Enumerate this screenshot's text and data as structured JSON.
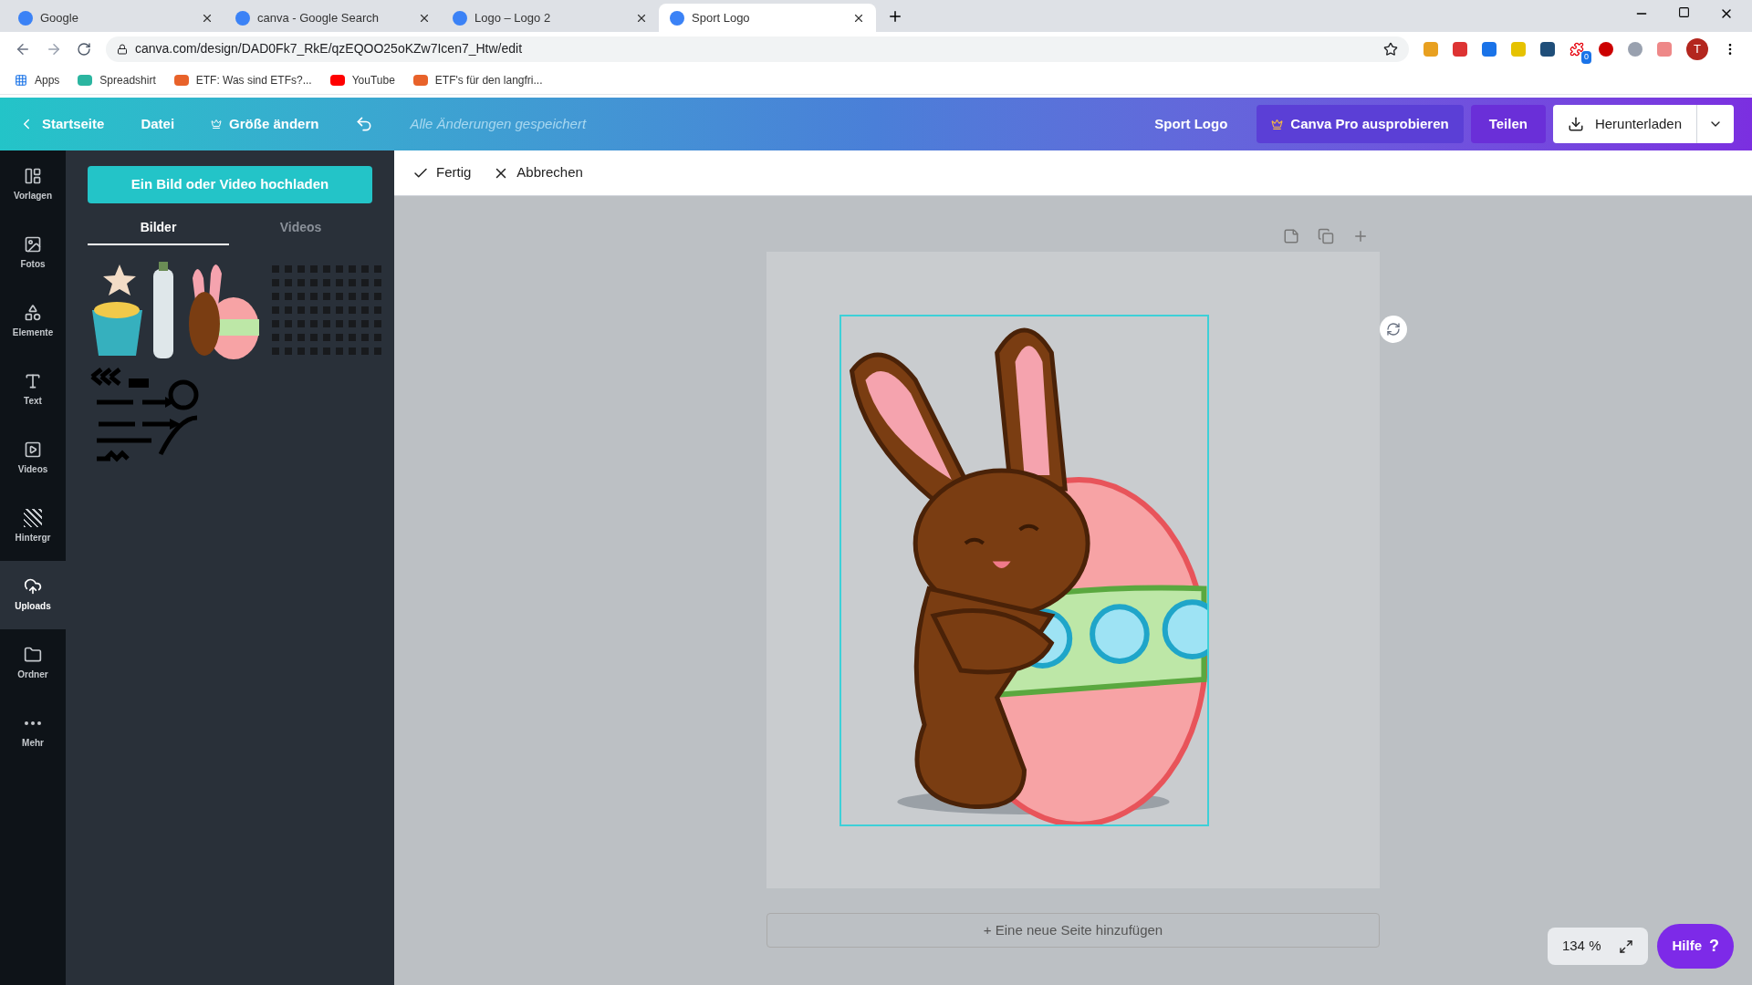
{
  "browser": {
    "tabs": [
      {
        "title": "Google",
        "selected": false
      },
      {
        "title": "canva - Google Search",
        "selected": false
      },
      {
        "title": "Logo – Logo 2",
        "selected": false
      },
      {
        "title": "Sport Logo",
        "selected": true
      }
    ],
    "url": "canva.com/design/DAD0Fk7_RkE/qzEQOO25oKZw7Icen7_Htw/edit",
    "bookmarks": [
      "Apps",
      "Spreadshirt",
      "ETF: Was sind ETFs?...",
      "YouTube",
      "ETF's für den langfri..."
    ],
    "profile_initial": "T",
    "extension_badge": "0"
  },
  "header": {
    "back": "Startseite",
    "file": "Datei",
    "resize": "Größe ändern",
    "status": "Alle Änderungen gespeichert",
    "design_title": "Sport Logo",
    "pro": "Canva Pro ausprobieren",
    "share": "Teilen",
    "download": "Herunterladen"
  },
  "rail": [
    {
      "label": "Vorlagen",
      "selected": false
    },
    {
      "label": "Fotos",
      "selected": false
    },
    {
      "label": "Elemente",
      "selected": false
    },
    {
      "label": "Text",
      "selected": false
    },
    {
      "label": "Videos",
      "selected": false
    },
    {
      "label": "Hintergr",
      "selected": false
    },
    {
      "label": "Uploads",
      "selected": true
    },
    {
      "label": "Ordner",
      "selected": false
    },
    {
      "label": "Mehr",
      "selected": false
    }
  ],
  "panel": {
    "upload_button": "Ein Bild oder Video hochladen",
    "tabs": [
      {
        "label": "Bilder",
        "selected": true
      },
      {
        "label": "Videos",
        "selected": false
      }
    ]
  },
  "toolbar": {
    "done": "Fertig",
    "cancel": "Abbrechen"
  },
  "canvas": {
    "add_page": "+ Eine neue Seite hinzufügen",
    "zoom": "134 %",
    "help": "Hilfe",
    "help_mark": "?"
  }
}
